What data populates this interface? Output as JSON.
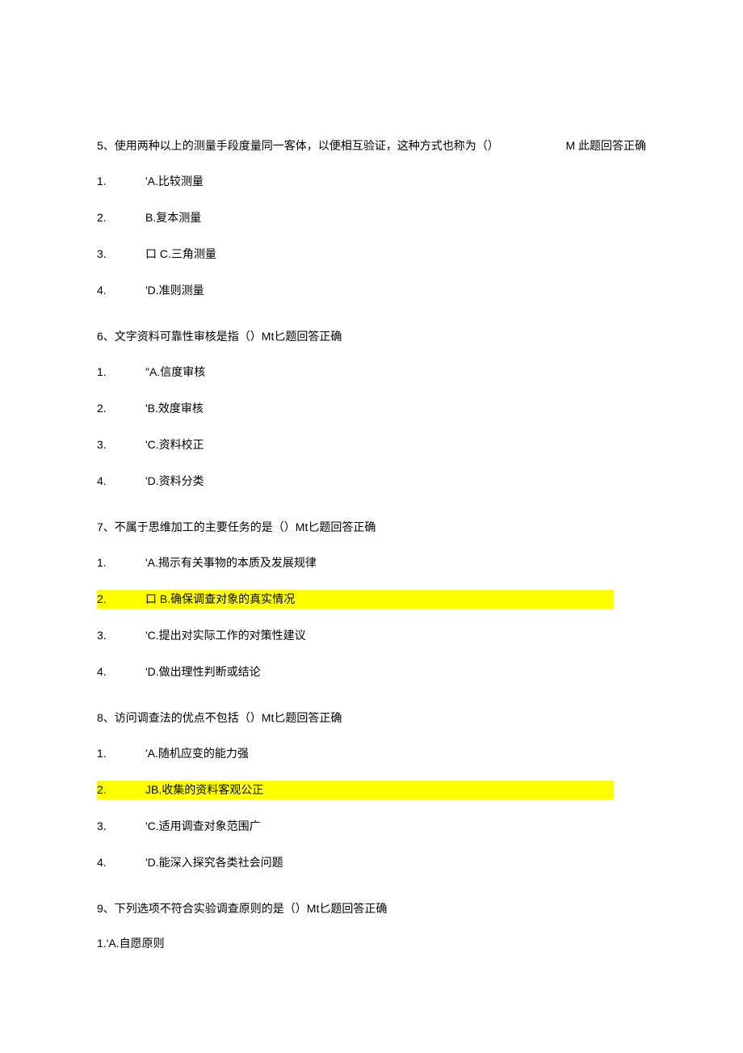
{
  "q5": {
    "header": "5、使用两种以上的测量手段度量同一客体，以便相互验证，这种方式也称为（）",
    "feedback": "M 此题回答正确",
    "options": [
      {
        "num": "1.",
        "text": "'A.比较测量"
      },
      {
        "num": "2.",
        "text": "B.复本测量"
      },
      {
        "num": "3.",
        "text": "口 C.三角测量"
      },
      {
        "num": "4.",
        "text": "'D.准则测量"
      }
    ]
  },
  "q6": {
    "header": "6、文字资料可靠性审核是指（）Mt匕题回答正确",
    "options": [
      {
        "num": "1.",
        "text": "\"A.信度审核"
      },
      {
        "num": "2.",
        "text": "'B.效度审核"
      },
      {
        "num": "3.",
        "text": "'C.资料校正"
      },
      {
        "num": "4.",
        "text": "'D.资料分类"
      }
    ]
  },
  "q7": {
    "header": "7、不属于思维加工的主要任务的是（）Mt匕题回答正确",
    "options": [
      {
        "num": "1.",
        "text": "'A.揭示有关事物的本质及发展规律",
        "hl": false
      },
      {
        "num": "2.",
        "text": "口 B.确保调查对象的真实情况",
        "hl": true
      },
      {
        "num": "3.",
        "text": "'C.提出对实际工作的对策性建议",
        "hl": false
      },
      {
        "num": "4.",
        "text": "'D.做出理性判断或结论",
        "hl": false
      }
    ]
  },
  "q8": {
    "header": "8、访问调查法的优点不包括（）Mt匕题回答正确",
    "options": [
      {
        "num": "1.",
        "text": "'A.随机应变的能力强",
        "hl": false
      },
      {
        "num": "2.",
        "text": "JB.收集的资料客观公正",
        "hl": true
      },
      {
        "num": "3.",
        "text": "'C.适用调查对象范围广",
        "hl": false
      },
      {
        "num": "4.",
        "text": "'D.能深入探究各类社会问题",
        "hl": false
      }
    ]
  },
  "q9": {
    "header": "9、下列选项不符合实验调查原则的是（）Mt匕题回答正确",
    "option1": "1.'A.自愿原则"
  }
}
